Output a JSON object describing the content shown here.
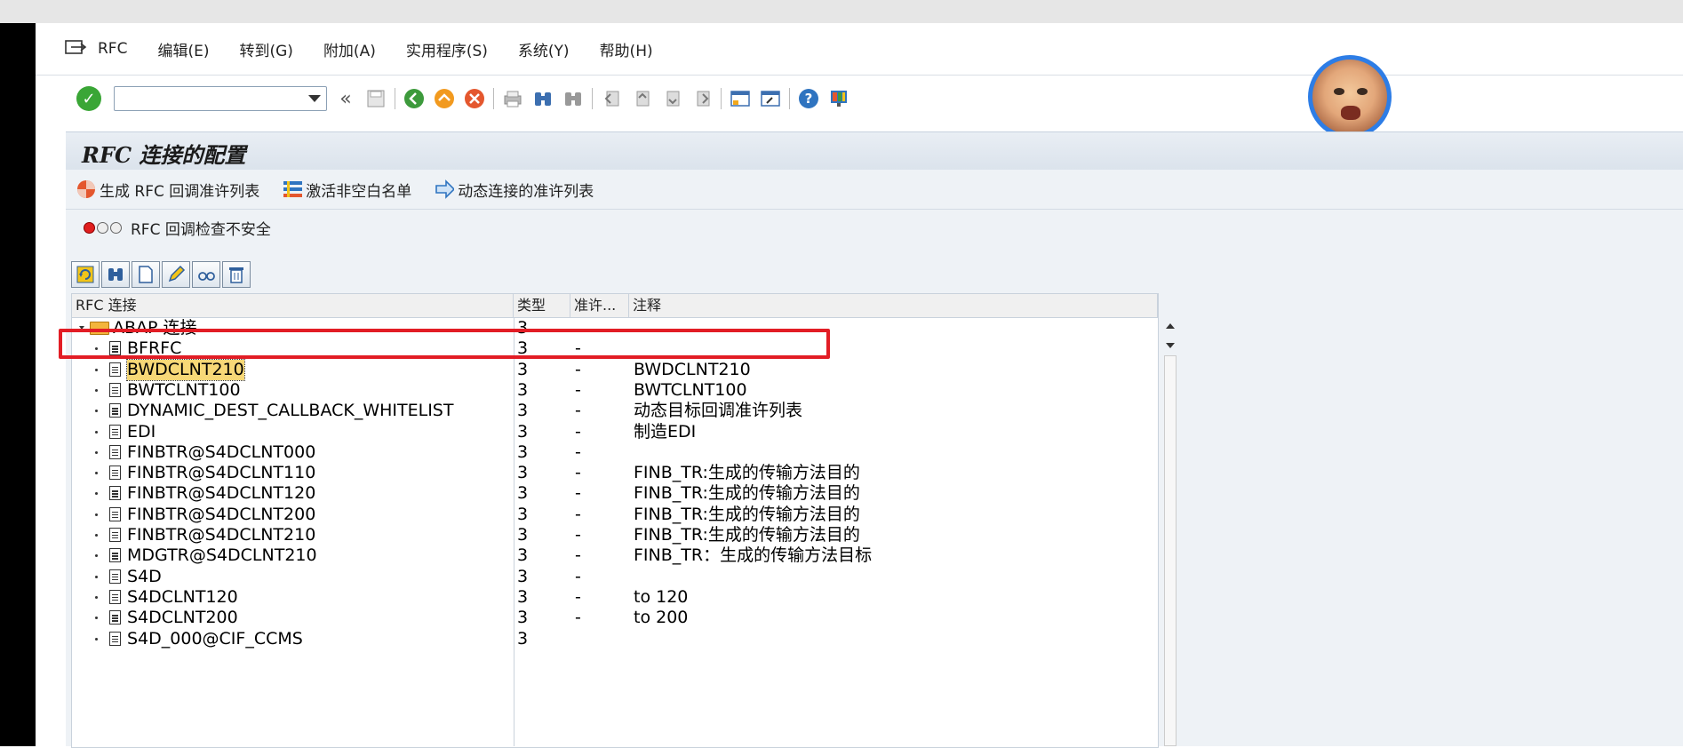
{
  "menu": {
    "items": [
      "RFC",
      "编辑(E)",
      "转到(G)",
      "附加(A)",
      "实用程序(S)",
      "系统(Y)",
      "帮助(H)"
    ]
  },
  "toolbar": {
    "command_value": "",
    "icons": [
      "ok-icon",
      "back-icon",
      "save-icon",
      "exit-icon",
      "home-icon",
      "cancel-icon",
      "print-icon",
      "find-icon",
      "find-next-icon",
      "first-page-icon",
      "prev-page-icon",
      "next-page-icon",
      "last-page-icon",
      "create-session-icon",
      "shortcut-icon",
      "help-icon",
      "layout-icon"
    ]
  },
  "title": "RFC 连接的配置",
  "app_toolbar": {
    "btn1": "生成 RFC 回调准许列表",
    "btn2": "激活非空白名单",
    "btn3": "动态连接的准许列表"
  },
  "status": {
    "text": "RFC 回调检查不安全",
    "light": "red"
  },
  "grid": {
    "headers": {
      "name": "RFC 连接",
      "type": "类型",
      "allow": "准许...",
      "comment": "注释"
    },
    "root": {
      "name": "ABAP 连接",
      "type": "3"
    },
    "rows": [
      {
        "name": "BFRFC",
        "type": "3",
        "allow": "-",
        "comment": ""
      },
      {
        "name": "BWDCLNT210",
        "type": "3",
        "allow": "-",
        "comment": "BWDCLNT210"
      },
      {
        "name": "BWTCLNT100",
        "type": "3",
        "allow": "-",
        "comment": "BWTCLNT100"
      },
      {
        "name": "DYNAMIC_DEST_CALLBACK_WHITELIST",
        "type": "3",
        "allow": "-",
        "comment": "动态目标回调准许列表"
      },
      {
        "name": "EDI",
        "type": "3",
        "allow": "-",
        "comment": "制造EDI"
      },
      {
        "name": "FINBTR@S4DCLNT000",
        "type": "3",
        "allow": "-",
        "comment": ""
      },
      {
        "name": "FINBTR@S4DCLNT110",
        "type": "3",
        "allow": "-",
        "comment": "FINB_TR:生成的传输方法目的"
      },
      {
        "name": "FINBTR@S4DCLNT120",
        "type": "3",
        "allow": "-",
        "comment": "FINB_TR:生成的传输方法目的"
      },
      {
        "name": "FINBTR@S4DCLNT200",
        "type": "3",
        "allow": "-",
        "comment": "FINB_TR:生成的传输方法目的"
      },
      {
        "name": "FINBTR@S4DCLNT210",
        "type": "3",
        "allow": "-",
        "comment": "FINB_TR:生成的传输方法目的"
      },
      {
        "name": "MDGTR@S4DCLNT210",
        "type": "3",
        "allow": "-",
        "comment": "FINB_TR：生成的传输方法目标"
      },
      {
        "name": "S4D",
        "type": "3",
        "allow": "-",
        "comment": ""
      },
      {
        "name": "S4DCLNT120",
        "type": "3",
        "allow": "-",
        "comment": "to 120"
      },
      {
        "name": "S4DCLNT200",
        "type": "3",
        "allow": "-",
        "comment": "to 200"
      },
      {
        "name": "S4D_000@CIF_CCMS",
        "type": "3",
        "allow": "",
        "comment": ""
      }
    ],
    "selected_index": 1
  },
  "colors": {
    "highlight_box": "#e21d25",
    "selection": "#f7d877",
    "avatar_border": "#2d7de6"
  }
}
